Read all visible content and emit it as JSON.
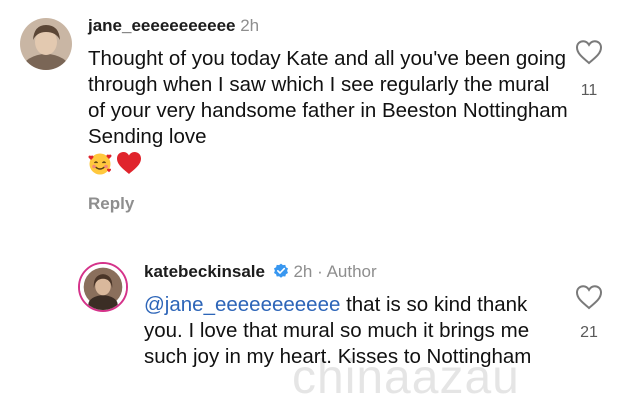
{
  "comment": {
    "username": "jane_eeeeeeeeeee",
    "time": "2h",
    "text": "Thought of you today Kate and all you've been going through when I saw which I see regularly the mural of your very handsome father in Beeston Nottingham Sending love",
    "emojis": [
      "smiling-face-with-hearts",
      "red-heart"
    ],
    "like_count": "11",
    "reply_label": "Reply"
  },
  "reply": {
    "username": "katebeckinsale",
    "time": "2h",
    "separator": "·",
    "author_label": "Author",
    "mention": "@jane_eeeeeeeeeee",
    "text": " that is so kind thank you. I love that mural so much it brings me such joy in my heart. Kisses to Nottingham",
    "like_count": "21"
  },
  "watermark": "chinaazau",
  "colors": {
    "mention": "#2d65b8",
    "meta": "#8e8e8e",
    "heart_emoji": "#e0242c",
    "verified": "#3897f0"
  }
}
